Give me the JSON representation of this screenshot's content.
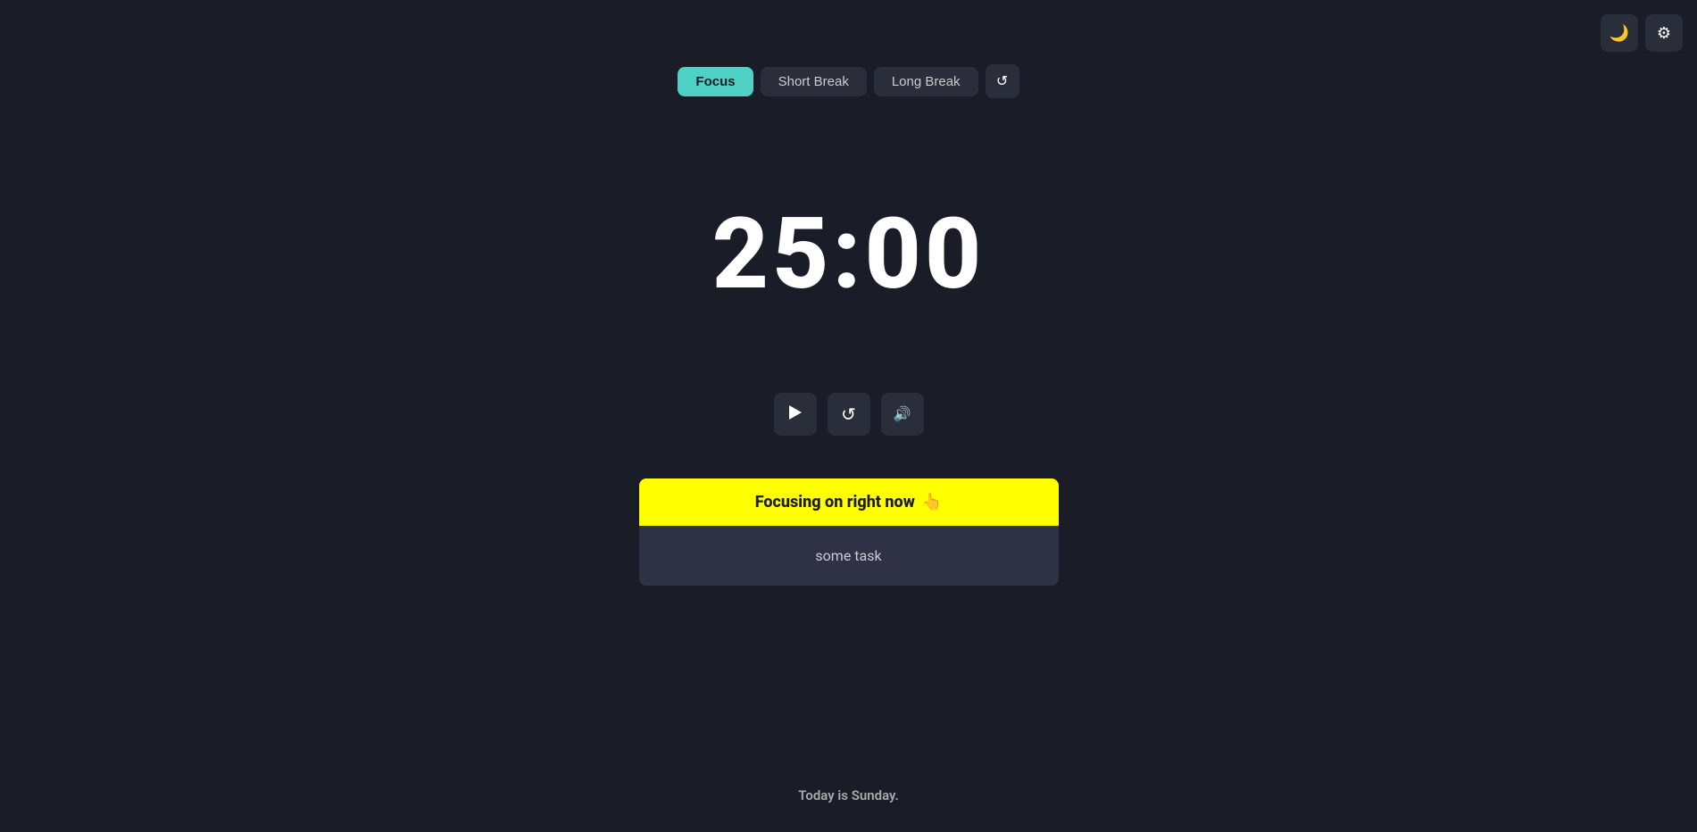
{
  "topControls": {
    "moonLabel": "🌙",
    "settingsLabel": "⚙"
  },
  "modeTabs": [
    {
      "id": "focus",
      "label": "Focus",
      "active": true
    },
    {
      "id": "short-break",
      "label": "Short Break",
      "active": false
    },
    {
      "id": "long-break",
      "label": "Long Break",
      "active": false
    }
  ],
  "timer": {
    "display": "25:00"
  },
  "controls": {
    "playLabel": "▶",
    "resetLabel": "↺",
    "soundLabel": "🔊"
  },
  "focusCard": {
    "headerText": "Focusing on right now",
    "cursorIcon": "👆",
    "taskText": "some task"
  },
  "footer": {
    "text": "Today is Sunday."
  },
  "colors": {
    "accent": "#4fd1c5",
    "yellow": "#ffff00",
    "bg": "#1a1d27",
    "cardBg": "#2e3244",
    "btnBg": "#2a2d3a"
  }
}
